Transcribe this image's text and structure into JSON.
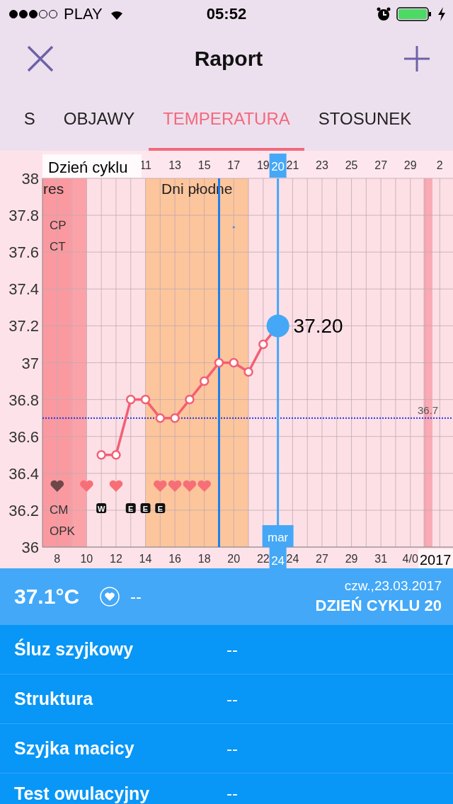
{
  "status_bar": {
    "carrier": "PLAY",
    "time": "05:52"
  },
  "nav": {
    "title": "Raport"
  },
  "tabs": [
    {
      "label": "S",
      "selected": false
    },
    {
      "label": "OBJAWY",
      "selected": false
    },
    {
      "label": "TEMPERATURA",
      "selected": true
    },
    {
      "label": "STOSUNEK",
      "selected": false
    }
  ],
  "chart": {
    "heart_row": [
      {
        "kind": "heart",
        "color": "#6e4848"
      },
      {
        "kind": "blank"
      },
      {
        "kind": "heart",
        "color": "#f76f76"
      },
      {
        "kind": "blank"
      },
      {
        "kind": "heart",
        "color": "#f76f76"
      },
      {
        "kind": "blank"
      },
      {
        "kind": "blank"
      },
      {
        "kind": "heart",
        "color": "#f76f76"
      },
      {
        "kind": "heart",
        "color": "#f76f76"
      },
      {
        "kind": "heart",
        "color": "#f76f76"
      },
      {
        "kind": "heart",
        "color": "#f76f76"
      }
    ],
    "cm_row": [
      {
        "kind": "blank"
      },
      {
        "kind": "blank"
      },
      {
        "kind": "blank"
      },
      {
        "kind": "badge",
        "label": "W"
      },
      {
        "kind": "blank"
      },
      {
        "kind": "badge",
        "label": "E"
      },
      {
        "kind": "badge",
        "label": "E"
      },
      {
        "kind": "badge",
        "label": "E"
      }
    ],
    "next_cycle_tick": "2",
    "date_labels": [
      "8",
      "10",
      "12",
      "14",
      "16",
      "18",
      "20",
      "22",
      "24",
      "27",
      "29",
      "31",
      "4/0"
    ],
    "year": "2017",
    "row_labels": [
      "CP",
      "CT",
      "CM",
      "OPK"
    ],
    "selected": {
      "cycle_day": "20",
      "month": "mar",
      "date": "24",
      "reading": "37.20"
    },
    "chart_data": {
      "type": "line",
      "xlabel": "Dzień cyklu",
      "x": [
        8,
        9,
        10,
        11,
        12,
        13,
        14,
        15,
        16,
        17,
        18,
        19,
        20
      ],
      "series": [
        {
          "color": "#f25f74",
          "marker": "circle",
          "values": [
            36.5,
            36.5,
            36.8,
            36.8,
            36.7,
            36.7,
            36.8,
            36.9,
            37.0,
            37.0,
            36.95,
            37.1,
            37.2
          ]
        }
      ],
      "xlim": [
        4,
        31.9
      ],
      "ylim": [
        36,
        38
      ],
      "grid": true,
      "xticks": [
        11,
        13,
        15,
        17,
        19,
        21,
        23,
        25,
        27,
        29
      ],
      "yticks": [
        {
          "value": 36,
          "label": "36"
        },
        {
          "value": 36.2,
          "label": "36.2"
        },
        {
          "value": 36.4,
          "label": "36.4"
        },
        {
          "value": 36.6,
          "label": "36.6"
        },
        {
          "value": 36.8,
          "label": "36.8"
        },
        {
          "value": 37,
          "label": "37"
        },
        {
          "value": 37.2,
          "label": "37.2"
        },
        {
          "value": 37.4,
          "label": "37.4"
        },
        {
          "value": 37.6,
          "label": "37.6"
        },
        {
          "value": 37.8,
          "label": "37.8"
        },
        {
          "value": 38,
          "label": "38"
        }
      ],
      "bands": [
        {
          "axis": "x",
          "from": 4,
          "to": 7,
          "label": "res",
          "color": "#fba2a8"
        },
        {
          "axis": "x",
          "from": 11,
          "to": 18,
          "label": "Dni płodne",
          "color": "#fdc59c"
        },
        {
          "axis": "x",
          "from": 29.9,
          "to": 30.5,
          "color": "#f9aab4"
        }
      ],
      "ref_lines": [
        {
          "axis": "x",
          "value": 16,
          "color": "#1a7ef0"
        },
        {
          "axis": "x",
          "value": 20,
          "color": "#44a8f7"
        },
        {
          "axis": "y",
          "value": 36.7,
          "label": "36.7",
          "color": "#2236e0"
        }
      ]
    }
  },
  "summary": {
    "temperature": "37.1°C",
    "sex": "--",
    "date": "czw.,23.03.2017",
    "cycle_day": "DZIEŃ CYKLU 20"
  },
  "details": [
    {
      "label": "Śluz szyjkowy",
      "value": "--"
    },
    {
      "label": "Struktura",
      "value": "--"
    },
    {
      "label": "Szyjka macicy",
      "value": "--"
    },
    {
      "label": "Test owulacyjny",
      "value": "--"
    }
  ]
}
